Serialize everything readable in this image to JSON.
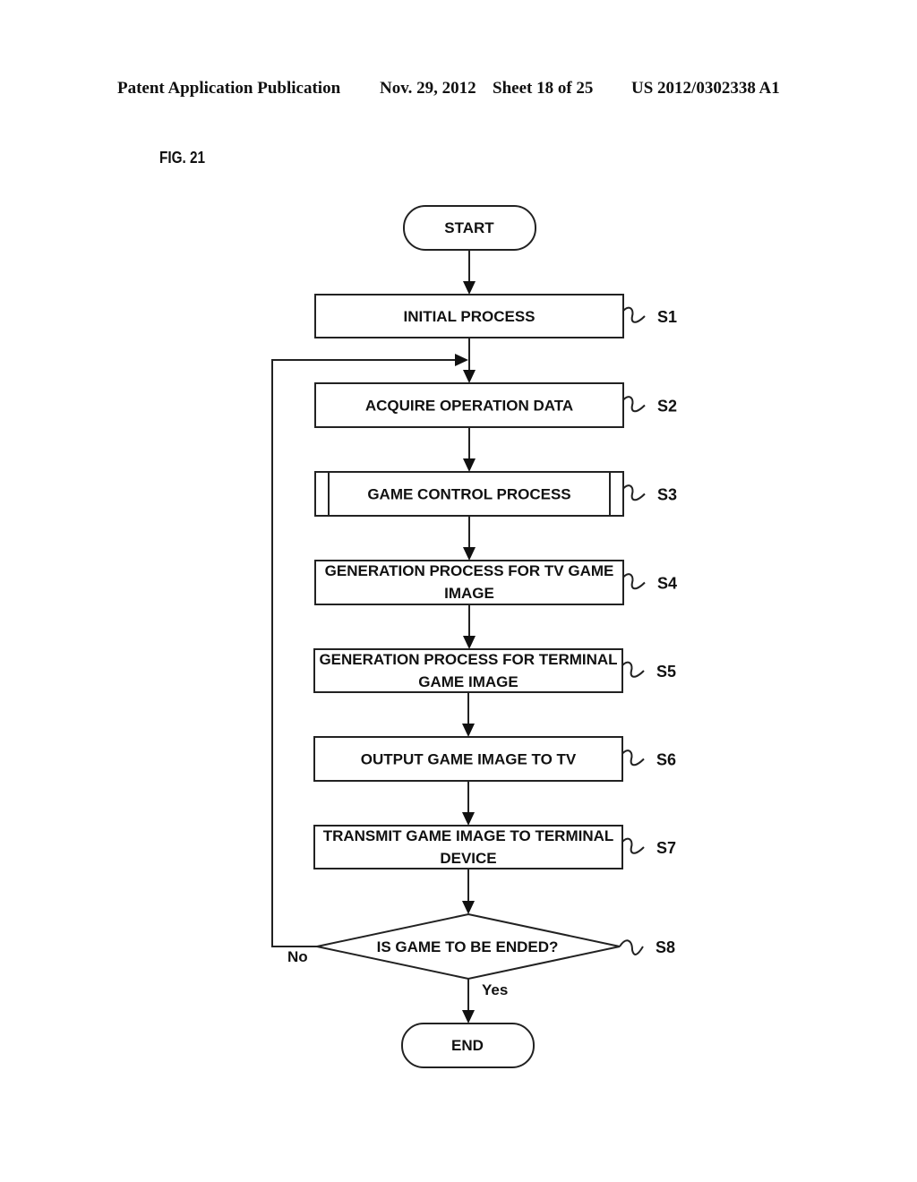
{
  "header": {
    "publication": "Patent Application Publication",
    "date": "Nov. 29, 2012",
    "sheet": "Sheet 18 of 25",
    "number": "US 2012/0302338 A1"
  },
  "figure": {
    "label": "FIG. 21"
  },
  "flowchart": {
    "start": "START",
    "end": "END",
    "steps": [
      {
        "id": "S1",
        "lines": [
          "INITIAL PROCESS"
        ],
        "type": "process"
      },
      {
        "id": "S2",
        "lines": [
          "ACQUIRE OPERATION DATA"
        ],
        "type": "process"
      },
      {
        "id": "S3",
        "lines": [
          "GAME CONTROL PROCESS"
        ],
        "type": "subroutine"
      },
      {
        "id": "S4",
        "lines": [
          "GENERATION PROCESS FOR TV GAME",
          "IMAGE"
        ],
        "type": "process"
      },
      {
        "id": "S5",
        "lines": [
          "GENERATION PROCESS FOR TERMINAL",
          "GAME IMAGE"
        ],
        "type": "process"
      },
      {
        "id": "S6",
        "lines": [
          "OUTPUT GAME IMAGE TO TV"
        ],
        "type": "process"
      },
      {
        "id": "S7",
        "lines": [
          "TRANSMIT GAME IMAGE TO TERMINAL",
          "DEVICE"
        ],
        "type": "process"
      }
    ],
    "decision": {
      "id": "S8",
      "text": "IS GAME TO BE ENDED?",
      "yes_label": "Yes",
      "no_label": "No"
    }
  }
}
